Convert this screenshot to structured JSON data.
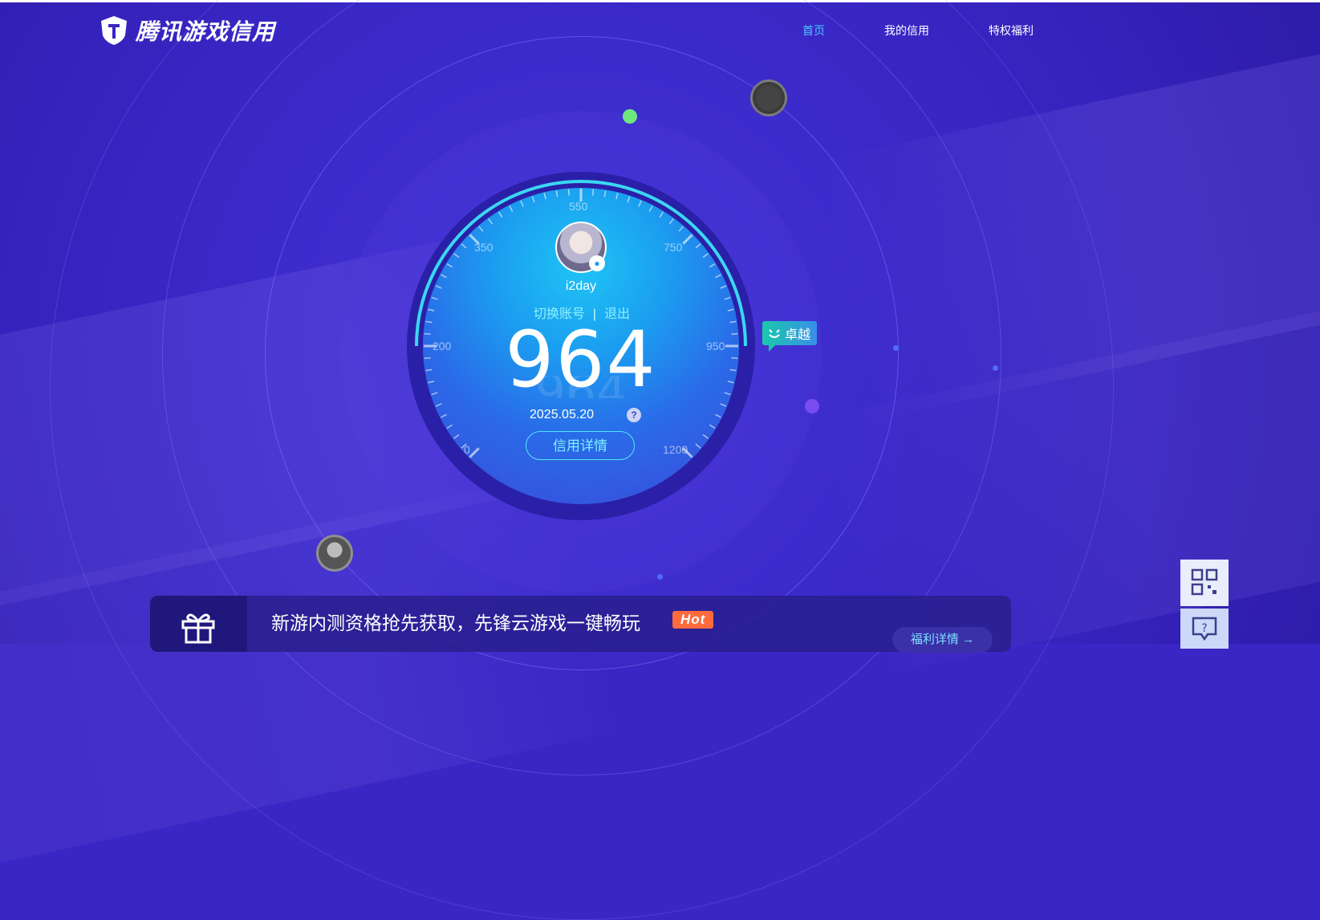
{
  "brand": {
    "title": "腾讯游戏信用"
  },
  "nav": {
    "items": [
      {
        "label": "首页",
        "active": true
      },
      {
        "label": "我的信用",
        "active": false
      },
      {
        "label": "特权福利",
        "active": false
      }
    ]
  },
  "user": {
    "name": "i2day",
    "switch_label": "切换账号",
    "separator": "|",
    "logout_label": "退出"
  },
  "credit": {
    "score": "964",
    "date": "2025.05.20",
    "help_symbol": "?",
    "detail_button": "信用详情",
    "level": "卓越",
    "scale_labels": [
      "0",
      "200",
      "350",
      "550",
      "750",
      "950",
      "1200"
    ]
  },
  "banner": {
    "title": "新游内测资格抢先获取，先锋云游戏一键畅玩",
    "tag": "Hot",
    "subtitle": "",
    "button": "福利详情"
  },
  "colors": {
    "background": "#3a26c4",
    "nav_active": "#4fc4ff",
    "dial_top": "#1fc4f5",
    "dial_bottom": "#3b48d8",
    "accent_cyan": "#4ee6ff",
    "hot_tag": "#ff6b3d",
    "level_badge_from": "#1ac9ac",
    "level_badge_to": "#3a8ee8"
  },
  "icons": {
    "logo": "shield-logo-icon",
    "qq_badge": "qq-penguin-icon",
    "help": "question-circle-icon",
    "gift": "gift-icon",
    "arrow": "arrow-right-icon",
    "qr": "qr-code-icon",
    "feedback": "feedback-question-icon",
    "smile": "smile-icon"
  }
}
